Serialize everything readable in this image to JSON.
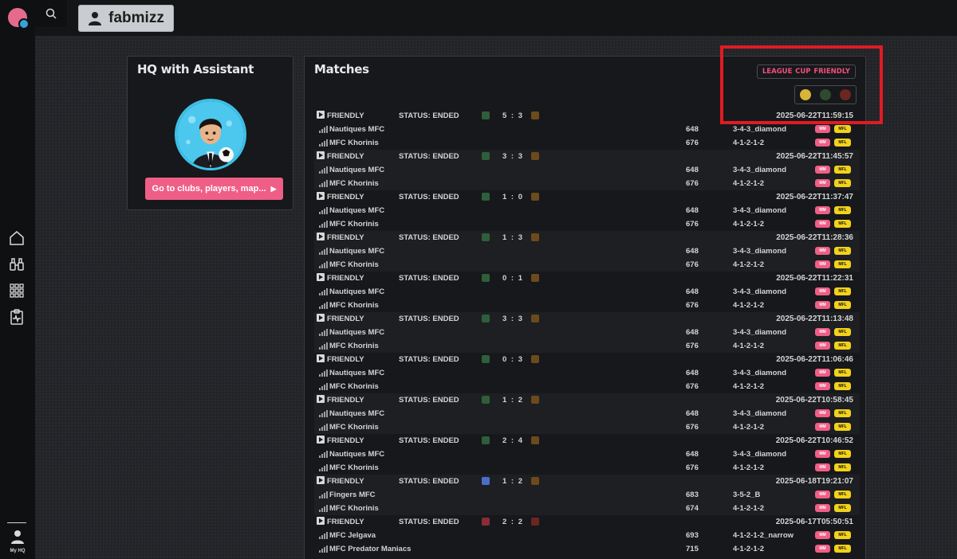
{
  "user": {
    "name": "fabmizz"
  },
  "sidebar": {
    "my_hq_label": "My HQ"
  },
  "hq": {
    "title": "HQ with Assistant",
    "cta_label": "Go to clubs, players, map..."
  },
  "matches": {
    "title": "Matches",
    "filters": [
      "LEAGUE",
      "CUP",
      "FRIENDLY"
    ],
    "pill_mm": "MM",
    "pill_mfl": "MFL",
    "items": [
      {
        "type": "FRIENDLY",
        "status": "STATUS: ENDED",
        "score": "5 : 3",
        "date": "2025-06-22T11:59:15",
        "home": {
          "name": "Nautiques MFC",
          "rating": "648",
          "formation": "3-4-3_diamond"
        },
        "away": {
          "name": "MFC Khorinis",
          "rating": "676",
          "formation": "4-1-2-1-2"
        }
      },
      {
        "type": "FRIENDLY",
        "status": "STATUS: ENDED",
        "score": "3 : 3",
        "date": "2025-06-22T11:45:57",
        "home": {
          "name": "Nautiques MFC",
          "rating": "648",
          "formation": "3-4-3_diamond"
        },
        "away": {
          "name": "MFC Khorinis",
          "rating": "676",
          "formation": "4-1-2-1-2"
        }
      },
      {
        "type": "FRIENDLY",
        "status": "STATUS: ENDED",
        "score": "1 : 0",
        "date": "2025-06-22T11:37:47",
        "home": {
          "name": "Nautiques MFC",
          "rating": "648",
          "formation": "3-4-3_diamond"
        },
        "away": {
          "name": "MFC Khorinis",
          "rating": "676",
          "formation": "4-1-2-1-2"
        }
      },
      {
        "type": "FRIENDLY",
        "status": "STATUS: ENDED",
        "score": "1 : 3",
        "date": "2025-06-22T11:28:36",
        "home": {
          "name": "Nautiques MFC",
          "rating": "648",
          "formation": "3-4-3_diamond"
        },
        "away": {
          "name": "MFC Khorinis",
          "rating": "676",
          "formation": "4-1-2-1-2"
        }
      },
      {
        "type": "FRIENDLY",
        "status": "STATUS: ENDED",
        "score": "0 : 1",
        "date": "2025-06-22T11:22:31",
        "home": {
          "name": "Nautiques MFC",
          "rating": "648",
          "formation": "3-4-3_diamond"
        },
        "away": {
          "name": "MFC Khorinis",
          "rating": "676",
          "formation": "4-1-2-1-2"
        }
      },
      {
        "type": "FRIENDLY",
        "status": "STATUS: ENDED",
        "score": "3 : 3",
        "date": "2025-06-22T11:13:48",
        "home": {
          "name": "Nautiques MFC",
          "rating": "648",
          "formation": "3-4-3_diamond"
        },
        "away": {
          "name": "MFC Khorinis",
          "rating": "676",
          "formation": "4-1-2-1-2"
        }
      },
      {
        "type": "FRIENDLY",
        "status": "STATUS: ENDED",
        "score": "0 : 3",
        "date": "2025-06-22T11:06:46",
        "home": {
          "name": "Nautiques MFC",
          "rating": "648",
          "formation": "3-4-3_diamond"
        },
        "away": {
          "name": "MFC Khorinis",
          "rating": "676",
          "formation": "4-1-2-1-2"
        }
      },
      {
        "type": "FRIENDLY",
        "status": "STATUS: ENDED",
        "score": "1 : 2",
        "date": "2025-06-22T10:58:45",
        "home": {
          "name": "Nautiques MFC",
          "rating": "648",
          "formation": "3-4-3_diamond"
        },
        "away": {
          "name": "MFC Khorinis",
          "rating": "676",
          "formation": "4-1-2-1-2"
        }
      },
      {
        "type": "FRIENDLY",
        "status": "STATUS: ENDED",
        "score": "2 : 4",
        "date": "2025-06-22T10:46:52",
        "home": {
          "name": "Nautiques MFC",
          "rating": "648",
          "formation": "3-4-3_diamond"
        },
        "away": {
          "name": "MFC Khorinis",
          "rating": "676",
          "formation": "4-1-2-1-2"
        }
      },
      {
        "type": "FRIENDLY",
        "status": "STATUS: ENDED",
        "score": "1 : 2",
        "date": "2025-06-18T19:21:07",
        "home": {
          "name": "Fingers MFC",
          "rating": "683",
          "formation": "3-5-2_B"
        },
        "away": {
          "name": "MFC Khorinis",
          "rating": "674",
          "formation": "4-1-2-1-2"
        }
      },
      {
        "type": "FRIENDLY",
        "status": "STATUS: ENDED",
        "score": "2 : 2",
        "date": "2025-06-17T05:50:51",
        "home": {
          "name": "MFC Jelgava",
          "rating": "693",
          "formation": "4-1-2-1-2_narrow"
        },
        "away": {
          "name": "MFC Predator Maniacs",
          "rating": "715",
          "formation": "4-1-2-1-2"
        }
      }
    ]
  },
  "colors": {
    "accent": "#ef5e86",
    "highlight": "#e01b24",
    "mfl": "#f2d21b"
  }
}
